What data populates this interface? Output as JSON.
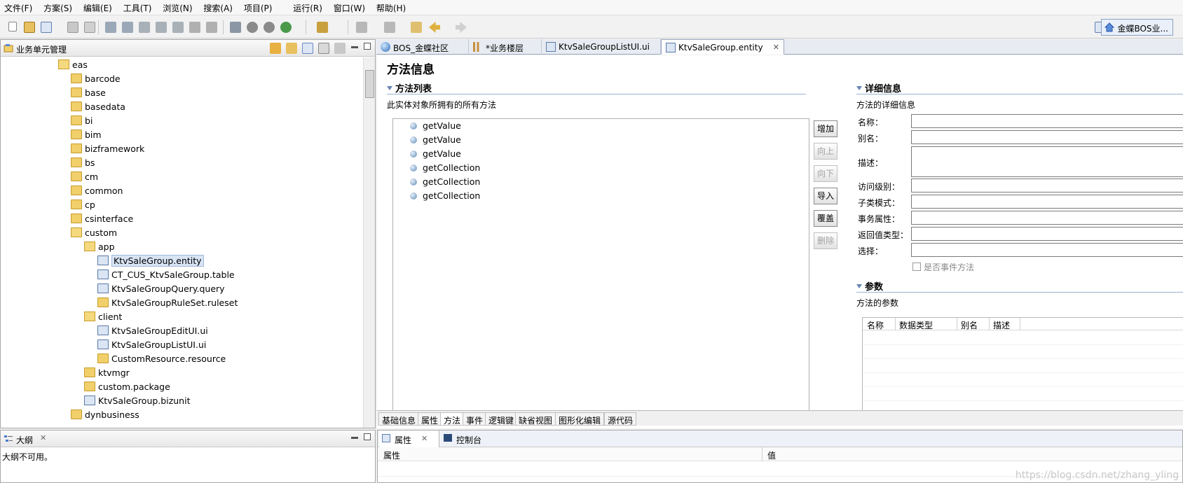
{
  "menu": [
    "文件(F)",
    "方案(S)",
    "编辑(E)",
    "工具(T)",
    "浏览(N)",
    "搜索(A)",
    "项目(P)",
    "运行(R)",
    "窗口(W)",
    "帮助(H)"
  ],
  "perspective": {
    "label": "金蝶BOS业..."
  },
  "navigator": {
    "title": "业务单元管理",
    "items": [
      {
        "label": "eas"
      },
      {
        "label": "barcode"
      },
      {
        "label": "base"
      },
      {
        "label": "basedata"
      },
      {
        "label": "bi"
      },
      {
        "label": "bim"
      },
      {
        "label": "bizframework"
      },
      {
        "label": "bs"
      },
      {
        "label": "cm"
      },
      {
        "label": "common"
      },
      {
        "label": "cp"
      },
      {
        "label": "csinterface"
      },
      {
        "label": "custom"
      },
      {
        "label": "app"
      },
      {
        "label": "KtvSaleGroup.entity"
      },
      {
        "label": "CT_CUS_KtvSaleGroup.table"
      },
      {
        "label": "KtvSaleGroupQuery.query"
      },
      {
        "label": "KtvSaleGroupRuleSet.ruleset"
      },
      {
        "label": "client"
      },
      {
        "label": "KtvSaleGroupEditUI.ui"
      },
      {
        "label": "KtvSaleGroupListUI.ui"
      },
      {
        "label": "CustomResource.resource"
      },
      {
        "label": "ktvmgr"
      },
      {
        "label": "custom.package"
      },
      {
        "label": "KtvSaleGroup.bizunit"
      },
      {
        "label": "dynbusiness"
      }
    ]
  },
  "outline": {
    "title": "大纲",
    "message": "大纲不可用。"
  },
  "editor_tabs": [
    {
      "label": "BOS_金蝶社区"
    },
    {
      "label": "*业务楼层"
    },
    {
      "label": "KtvSaleGroupListUI.ui"
    },
    {
      "label": "KtvSaleGroup.entity"
    }
  ],
  "editor": {
    "title": "方法信息",
    "methods_section": "方法列表",
    "methods_desc": "此实体对象所拥有的所有方法",
    "methods": [
      "getValue",
      "getValue",
      "getValue",
      "getCollection",
      "getCollection",
      "getCollection"
    ],
    "buttons": {
      "add": "增加",
      "up": "向上",
      "down": "向下",
      "import": "导入",
      "override": "覆盖",
      "delete": "删除"
    },
    "details_section": "详细信息",
    "details_desc": "方法的详细信息",
    "fields": {
      "name": "名称：",
      "alias": "别名：",
      "description": "描述：",
      "access": "访问级别：",
      "subclass": "子类模式：",
      "transaction": "事务属性：",
      "return_type": "返回值类型：",
      "select": "选择："
    },
    "event_checkbox": "是否事件方法",
    "params_section": "参数",
    "params_desc": "方法的参数",
    "param_columns": [
      "名称",
      "数据类型",
      "别名",
      "描述"
    ],
    "bottom_tabs": [
      "基础信息",
      "属性",
      "方法",
      "事件",
      "逻辑键",
      "缺省视图",
      "图形化编辑",
      "源代码"
    ]
  },
  "props_panel": {
    "tabs": [
      "属性",
      "控制台"
    ],
    "columns": [
      "属性",
      "值"
    ]
  },
  "watermark": "https://blog.csdn.net/zhang_yling"
}
